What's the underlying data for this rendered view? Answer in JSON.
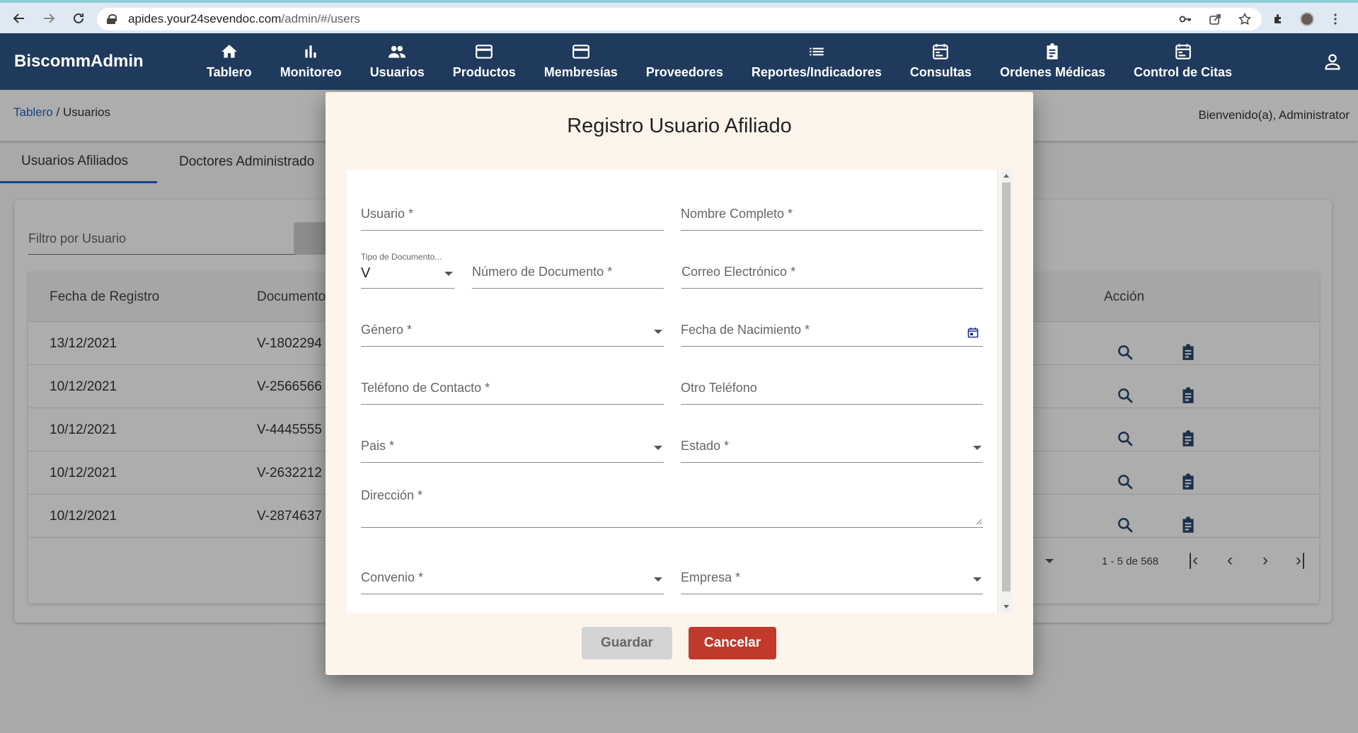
{
  "browser": {
    "url_host": "apides.your24sevendoc.com",
    "url_path": "/admin/#/users"
  },
  "header": {
    "brand": "BiscommAdmin",
    "nav": [
      {
        "label": "Tablero",
        "icon": "home-icon"
      },
      {
        "label": "Monitoreo",
        "icon": "bar-chart-icon"
      },
      {
        "label": "Usuarios",
        "icon": "people-icon"
      },
      {
        "label": "Productos",
        "icon": "card-icon"
      },
      {
        "label": "Membresías",
        "icon": "card-icon"
      },
      {
        "label": "Proveedores",
        "icon": "none"
      },
      {
        "label": "Reportes/Indicadores",
        "icon": "list-icon"
      },
      {
        "label": "Consultas",
        "icon": "calendar-icon"
      },
      {
        "label": "Ordenes Médicas",
        "icon": "clipboard-icon"
      },
      {
        "label": "Control de Citas",
        "icon": "calendar-icon"
      }
    ]
  },
  "breadcrumb": {
    "root": "Tablero",
    "separator": " / ",
    "current": "Usuarios"
  },
  "welcome": "Bienvenido(a), Administrator",
  "tabs": [
    "Usuarios Afiliados",
    "Doctores Administrado"
  ],
  "filter": {
    "placeholder": "Filtro por Usuario"
  },
  "table": {
    "headers": {
      "fecha": "Fecha de Registro",
      "documento": "Documento",
      "accion": "Acción"
    },
    "rows": [
      {
        "fecha": "13/12/2021",
        "documento": "V-1802294"
      },
      {
        "fecha": "10/12/2021",
        "documento": "V-2566566"
      },
      {
        "fecha": "10/12/2021",
        "documento": "V-4445555"
      },
      {
        "fecha": "10/12/2021",
        "documento": "V-2632212"
      },
      {
        "fecha": "10/12/2021",
        "documento": "V-2874637"
      }
    ],
    "pager": "1 - 5 de 568"
  },
  "modal": {
    "title": "Registro Usuario Afiliado",
    "fields": {
      "usuario": "Usuario *",
      "nombre": "Nombre Completo *",
      "tipo_doc_label": "Tipo de Documento...",
      "tipo_doc_value": "V",
      "numero_doc": "Número de Documento *",
      "correo": "Correo Electrónico *",
      "genero": "Género *",
      "fecha_nac": "Fecha de Nacimiento *",
      "telefono": "Teléfono de Contacto *",
      "otro_tel": "Otro Teléfono",
      "pais": "Pais *",
      "estado": "Estado *",
      "direccion": "Dirección *",
      "convenio": "Convenio *",
      "empresa": "Empresa *"
    },
    "buttons": {
      "save": "Guardar",
      "cancel": "Cancelar"
    }
  },
  "colors": {
    "header_bg": "#1f3a5c",
    "cancel_bg": "#c0392b",
    "link": "#1e63c4",
    "modal_bg": "#fdf5ec"
  }
}
